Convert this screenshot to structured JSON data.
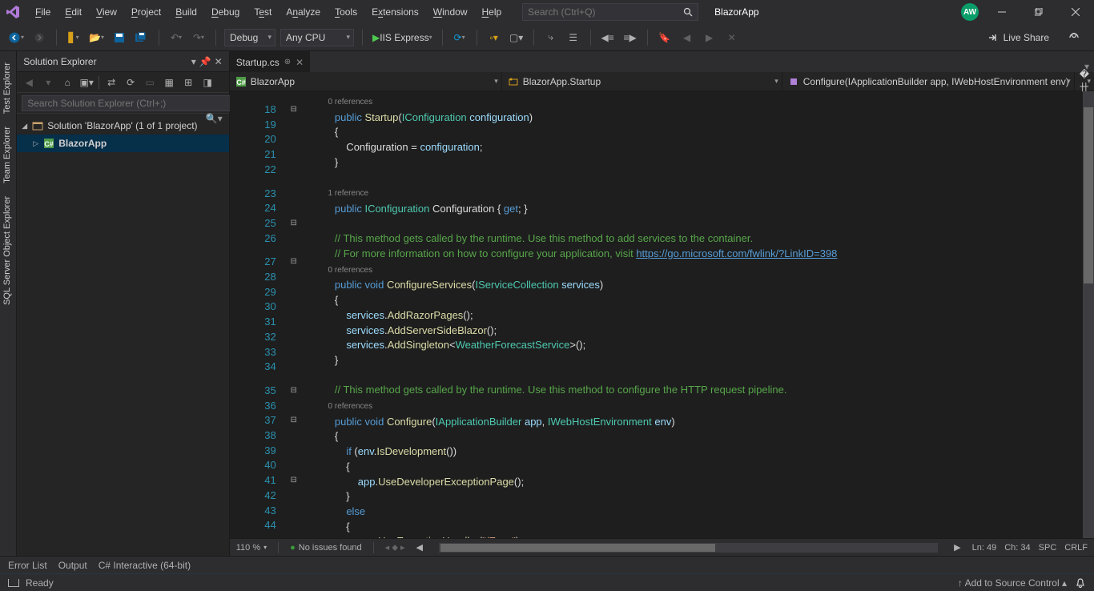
{
  "titlebar": {
    "menu": [
      "File",
      "Edit",
      "View",
      "Project",
      "Build",
      "Debug",
      "Test",
      "Analyze",
      "Tools",
      "Extensions",
      "Window",
      "Help"
    ],
    "search_placeholder": "Search (Ctrl+Q)",
    "app_name": "BlazorApp",
    "avatar": "AW"
  },
  "toolbar": {
    "config": "Debug",
    "platform": "Any CPU",
    "run": "IIS Express",
    "live_share": "Live Share"
  },
  "side_tabs": [
    "Test Explorer",
    "Team Explorer",
    "SQL Server Object Explorer"
  ],
  "solution_explorer": {
    "title": "Solution Explorer",
    "search_placeholder": "Search Solution Explorer (Ctrl+;)",
    "solution": "Solution 'BlazorApp' (1 of 1 project)",
    "project": "BlazorApp"
  },
  "editor": {
    "tab_name": "Startup.cs",
    "nav_project": "BlazorApp",
    "nav_class": "BlazorApp.Startup",
    "nav_member": "Configure(IApplicationBuilder app, IWebHostEnvironment env)",
    "line_start": 18,
    "line_end": 44,
    "codelens0": "0 references",
    "codelens1": "1 reference",
    "codelens2": "0 references",
    "codelens3": "0 references",
    "link1": "https://go.microsoft.com/fwlink/?LinkID=398",
    "link2": "https:/"
  },
  "editor_bottom": {
    "zoom": "110 %",
    "issues": "No issues found",
    "ln": "Ln: 49",
    "ch": "Ch: 34",
    "spc": "SPC",
    "crlf": "CRLF"
  },
  "bottom_tabs": [
    "Error List",
    "Output",
    "C# Interactive (64-bit)"
  ],
  "statusbar": {
    "ready": "Ready",
    "source_control": "Add to Source Control"
  }
}
